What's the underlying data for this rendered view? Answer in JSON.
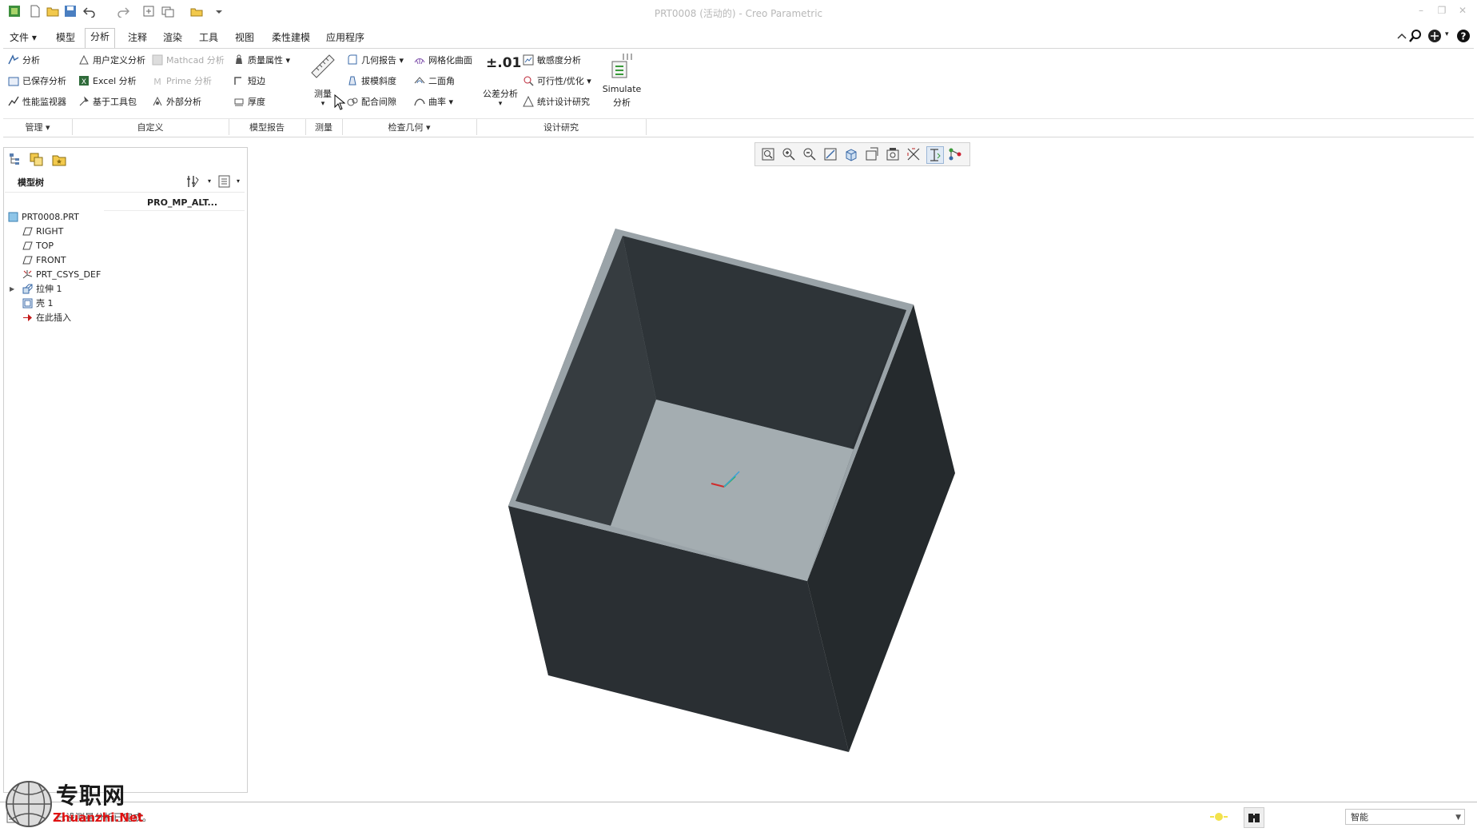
{
  "window": {
    "title": "PRT0008 (活动的) - Creo Parametric"
  },
  "menu": {
    "tabs": [
      "文件",
      "模型",
      "分析",
      "注释",
      "渲染",
      "工具",
      "视图",
      "柔性建模",
      "应用程序"
    ],
    "active_tab": "分析"
  },
  "ribbon": {
    "manage": {
      "items": [
        "分析",
        "已保存分析",
        "性能监视器"
      ],
      "label": "管理"
    },
    "custom": {
      "items": [
        "用户定义分析",
        "Excel 分析",
        "基于工具包",
        "Mathcad 分析",
        "Prime 分析",
        "外部分析"
      ],
      "label": "自定义"
    },
    "model_report": {
      "items": [
        "质量属性",
        "短边",
        "厚度"
      ],
      "label": "模型报告"
    },
    "measure": {
      "button": "测量",
      "label": "测量"
    },
    "inspect_geometry": {
      "items": [
        "几何报告",
        "拔模斜度",
        "配合间隙",
        "网格化曲面",
        "二面角",
        "曲率"
      ],
      "label": "检查几何"
    },
    "design_study": {
      "tolerance_icon_text": "±.01",
      "tolerance_button": "公差分析",
      "items": [
        "敏感度分析",
        "可行性/优化",
        "统计设计研究"
      ],
      "simulate_line1": "Simulate",
      "simulate_line2": "分析",
      "label": "设计研究"
    }
  },
  "model_tree": {
    "title": "模型树",
    "column_header": "PRO_MP_ALT...",
    "items": [
      {
        "label": "PRT0008.PRT",
        "icon": "part-icon"
      },
      {
        "label": "RIGHT",
        "icon": "datum-plane-icon"
      },
      {
        "label": "TOP",
        "icon": "datum-plane-icon"
      },
      {
        "label": "FRONT",
        "icon": "datum-plane-icon"
      },
      {
        "label": "PRT_CSYS_DEF",
        "icon": "csys-icon"
      },
      {
        "label": "拉伸 1",
        "icon": "extrude-icon"
      },
      {
        "label": "壳 1",
        "icon": "shell-icon"
      },
      {
        "label": "在此插入",
        "icon": "insert-here-icon"
      }
    ]
  },
  "graphics_toolbar": {
    "buttons": [
      "refit-icon",
      "zoom-in-icon",
      "zoom-out-icon",
      "repaint-icon",
      "display-style-icon",
      "saved-orientations-icon",
      "view-manager-icon",
      "perspective-icon",
      "datum-display-icon",
      "annotation-display-icon",
      "spin-center-icon"
    ]
  },
  "viewport": {
    "model_color": "#2d3236",
    "floor_color": "#a4adb1",
    "rim_color": "#9aa3a8"
  },
  "status": {
    "message": "已设测量分析已完成。",
    "selection_filter": "智能"
  },
  "watermark": {
    "zh": "专职网",
    "en": "Zhuanzhi.Net"
  }
}
